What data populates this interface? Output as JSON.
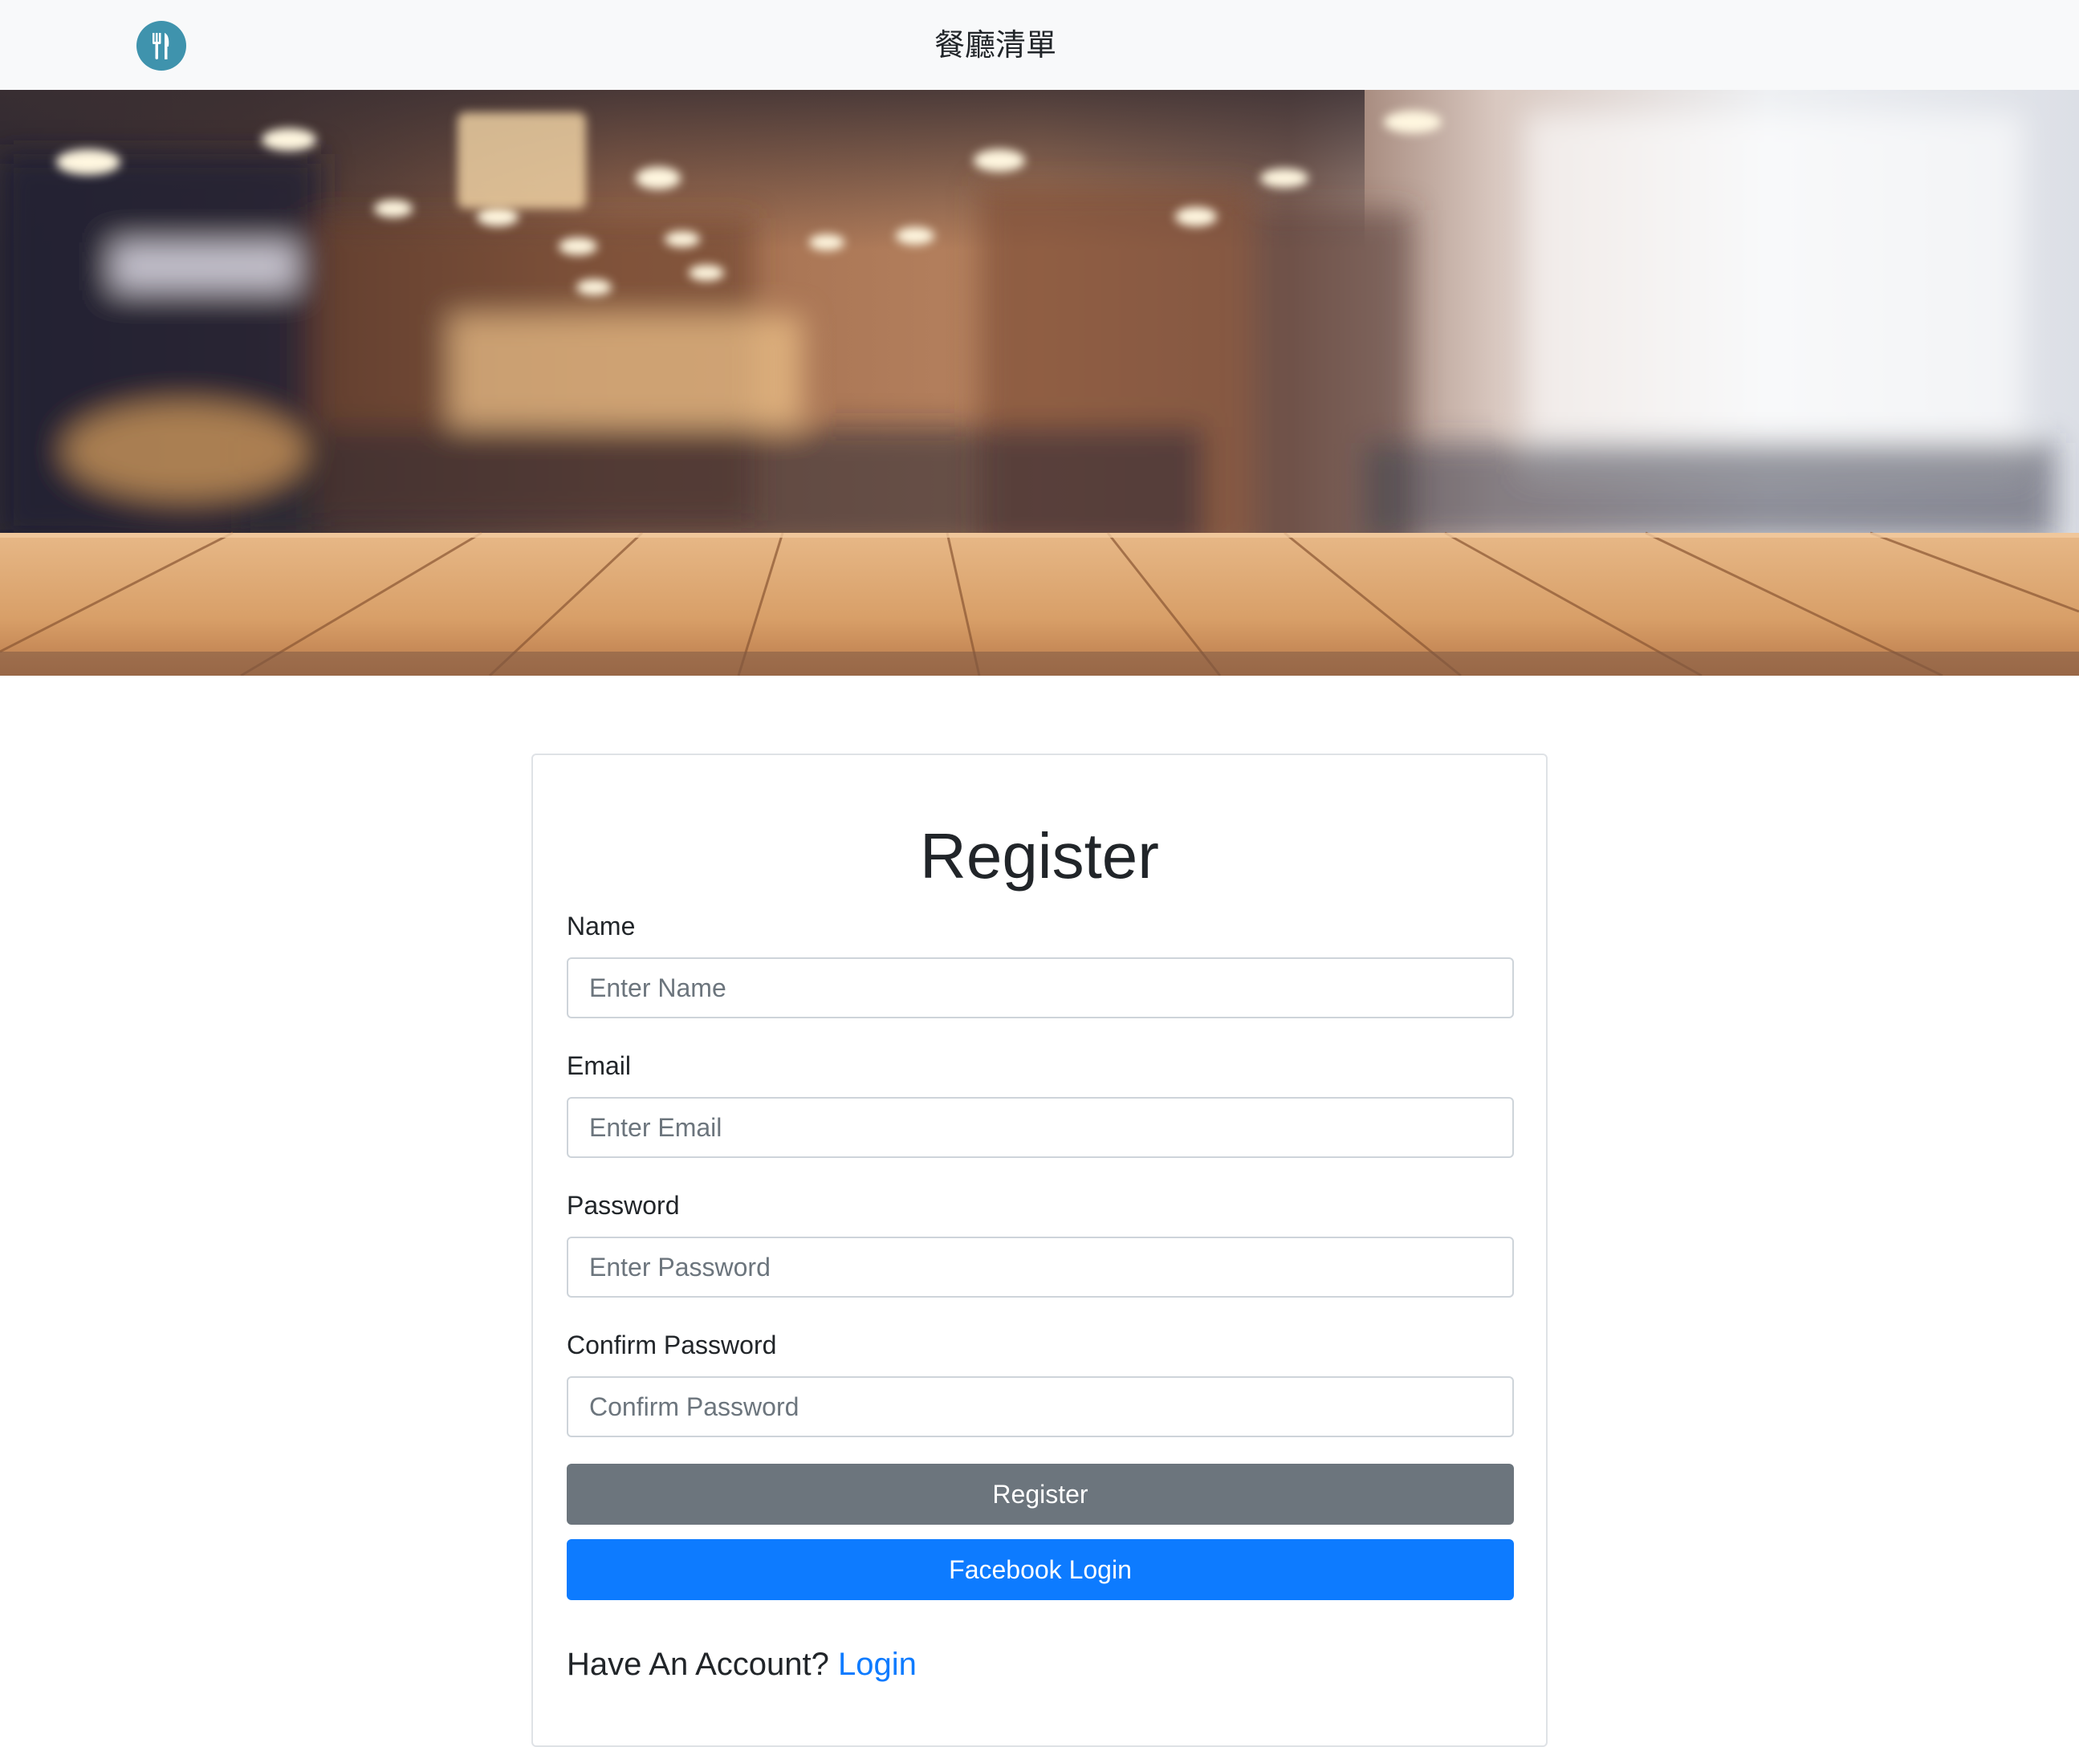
{
  "navbar": {
    "brand": "餐廳清單",
    "logo_icon": "fork-knife-icon",
    "background": "#f8f9fa",
    "logo_color": "#3f93ad"
  },
  "hero": {
    "image": "blurred-restaurant-interior-with-wooden-table"
  },
  "form": {
    "title": "Register",
    "name": {
      "label": "Name",
      "placeholder": "Enter Name",
      "value": ""
    },
    "email": {
      "label": "Email",
      "placeholder": "Enter Email",
      "value": ""
    },
    "password": {
      "label": "Password",
      "placeholder": "Enter Password",
      "value": ""
    },
    "confirm_password": {
      "label": "Confirm Password",
      "placeholder": "Confirm Password",
      "value": ""
    },
    "register_button": "Register",
    "facebook_button": "Facebook Login",
    "account_prompt": "Have An Account?",
    "login_link": "Login"
  },
  "colors": {
    "secondary": "#6c757d",
    "primary": "#0d7bff",
    "text": "#212529"
  }
}
